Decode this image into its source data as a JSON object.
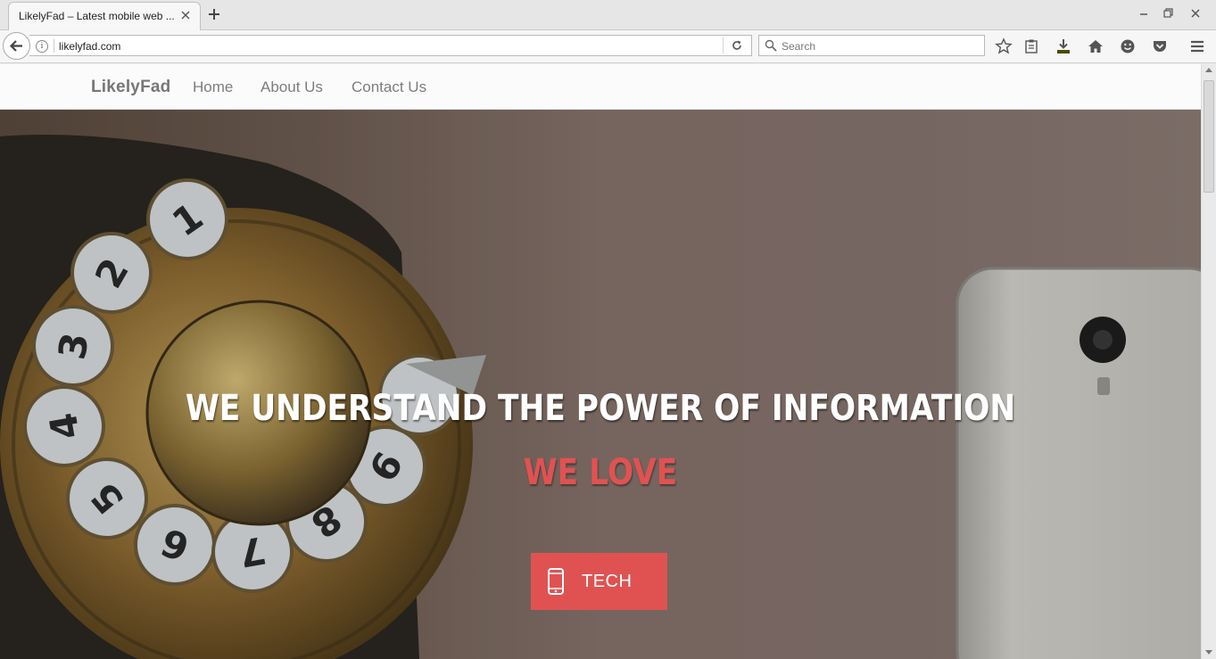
{
  "browser": {
    "tab_title": "LikelyFad – Latest mobile web ...",
    "url": "likelyfad.com",
    "search_placeholder": "Search"
  },
  "site": {
    "brand": "LikelyFad",
    "nav": [
      "Home",
      "About Us",
      "Contact Us"
    ]
  },
  "hero": {
    "headline": "WE UNDERSTAND THE POWER OF INFORMATION",
    "subhead": "WE LOVE",
    "button_label": "TECH",
    "accent_color": "#e05252"
  },
  "icons": {
    "back": "arrow-left-icon",
    "reload": "reload-icon",
    "bookmark": "star-icon",
    "reader": "clipboard-icon",
    "downloads": "download-icon",
    "home": "home-icon",
    "hello": "smiley-icon",
    "pocket": "pocket-icon",
    "menu": "hamburger-icon",
    "tech": "mobile-phone-icon"
  }
}
